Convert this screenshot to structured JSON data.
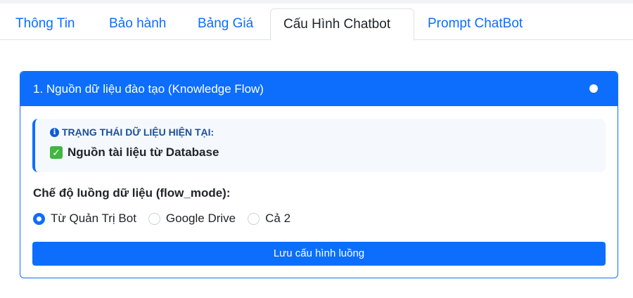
{
  "tabs": [
    {
      "label": "Thông Tin",
      "active": false
    },
    {
      "label": "Bảo hành",
      "active": false
    },
    {
      "label": "Bảng Giá",
      "active": false
    },
    {
      "label": "Cấu Hình Chatbot",
      "active": true
    },
    {
      "label": "Prompt ChatBot",
      "active": false
    }
  ],
  "card": {
    "header_title": "1. Nguồn dữ liệu đào tạo (Knowledge Flow)",
    "status": {
      "title": "TRẠNG THÁI DỮ LIỆU HIỆN TẠI:",
      "icon": "info-icon",
      "value": "Nguồn tài liệu từ Database",
      "value_icon": "check-mark-icon"
    },
    "flow_mode_label": "Chế độ luồng dữ liệu (flow_mode):",
    "flow_mode_options": [
      {
        "label": "Từ Quản Trị Bot",
        "checked": true
      },
      {
        "label": "Google Drive",
        "checked": false
      },
      {
        "label": "Cả 2",
        "checked": false
      }
    ],
    "save_button": "Lưu cấu hình luồng"
  },
  "colors": {
    "primary": "#0d6efd",
    "status_bg": "#f5f9fd",
    "status_title": "#1d4f99",
    "check_green": "#43b543"
  }
}
